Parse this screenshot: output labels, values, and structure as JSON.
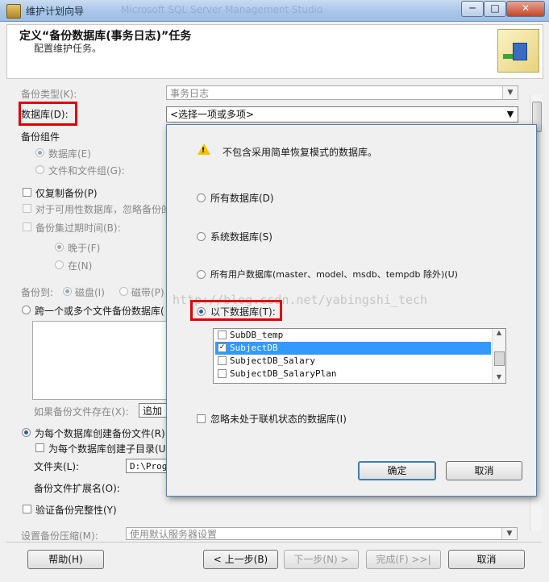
{
  "window": {
    "title": "维护计划向导",
    "behind_title": "Microsoft SQL Server Management Studio",
    "controls": {
      "minimize": "─",
      "maximize": "□",
      "close": "✕"
    }
  },
  "header": {
    "title": "定义“备份数据库(事务日志)”任务",
    "subtitle": "配置维护任务。"
  },
  "form": {
    "backup_type_label": "备份类型(K):",
    "backup_type_value": "事务日志",
    "database_label": "数据库(D):",
    "database_value": "<选择一项或多项>",
    "backup_component_label": "备份组件",
    "radio_database": "数据库(E)",
    "radio_file_filegroup": "文件和文件组(G):",
    "copy_only": "仅复制备份(P)",
    "availability": "对于可用性数据库，忽略备份的",
    "backup_set_expire": "备份集过期时间(B):",
    "after": "晚于(F)",
    "on": "在(N)",
    "backup_to": "备份到:",
    "disk": "磁盘(I)",
    "tape": "磁带(P)",
    "across_files": "跨一个或多个文件备份数据库(",
    "if_file_exists": "如果备份文件存在(X):",
    "if_file_exists_value": "追加",
    "create_file_per_db": "为每个数据库创建备份文件(R)",
    "create_subdir": "为每个数据库创建子目录(U)",
    "folder_label": "文件夹(L):",
    "folder_value": "D:\\Prog",
    "extension_label": "备份文件扩展名(O):",
    "verify": "验证备份完整性(Y)",
    "compression_label": "设置备份压缩(M):",
    "compression_value": "使用默认服务器设置"
  },
  "footer": {
    "help": "帮助(H)",
    "back": "< 上一步(B)",
    "next": "下一步(N) >",
    "finish": "完成(F) >>|",
    "cancel": "取消"
  },
  "popup": {
    "warning": "不包含采用简单恢复模式的数据库。",
    "all_databases": "所有数据库(D)",
    "system_databases": "系统数据库(S)",
    "user_databases": "所有用户数据库(master、model、msdb、tempdb 除外)(U)",
    "these_databases": "以下数据库(T):",
    "watermark": "http://blog.csdn.net/yabingshi_tech",
    "db_list": [
      {
        "name": "SubDB_temp",
        "checked": false,
        "selected": false
      },
      {
        "name": "SubjectDB",
        "checked": true,
        "selected": true
      },
      {
        "name": "SubjectDB_Salary",
        "checked": false,
        "selected": false
      },
      {
        "name": "SubjectDB_SalaryPlan",
        "checked": false,
        "selected": false
      }
    ],
    "ignore_offline": "忽略未处于联机状态的数据库(I)",
    "ok": "确定",
    "cancel": "取消"
  },
  "colors": {
    "annotation_red": "#e00000",
    "selection_blue": "#3399ff"
  }
}
